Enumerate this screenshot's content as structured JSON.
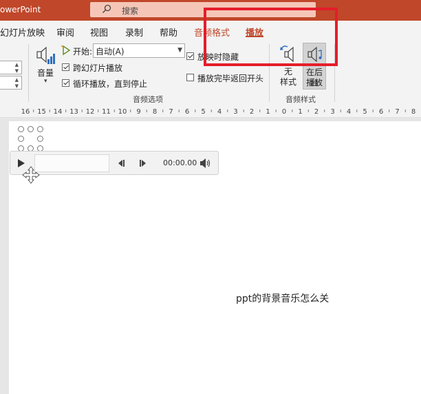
{
  "title_bar": {
    "app_title": "owerPoint",
    "search_label": "搜索"
  },
  "tabs": {
    "slideshow": "幻灯片放映",
    "review": "审阅",
    "view": "视图",
    "record": "录制",
    "help": "帮助",
    "audio_format": "音频格式",
    "playback": "播放"
  },
  "ribbon": {
    "volume_label": "音量",
    "start_label": "开始:",
    "start_value": "自动(A)",
    "cross_slides_label": "跨幻灯片播放",
    "loop_label": "循环播放，直到停止",
    "hide_label": "放映时隐藏",
    "rewind_label": "播放完毕返回开头",
    "audio_options_label": "音频选项",
    "no_style_label_1": "无",
    "no_style_label_2": "样式",
    "bg_play_label_1": "在后台",
    "bg_play_label_2": "播放",
    "audio_styles_label": "音频样式",
    "checkboxes": {
      "cross_slides": true,
      "loop": true,
      "hide": true,
      "rewind": false
    }
  },
  "ruler": {
    "left_numbers": [
      "16",
      "15",
      "14",
      "13",
      "12",
      "11",
      "10",
      "9",
      "8",
      "7",
      "6",
      "5",
      "4",
      "3",
      "2",
      "1",
      "0"
    ],
    "right_numbers": [
      "1",
      "2",
      "3",
      "4",
      "5",
      "6",
      "7",
      "8"
    ]
  },
  "audio_player": {
    "time": "00:00.00"
  },
  "slide": {
    "caption": "ppt的背景音乐怎么关"
  },
  "colors": {
    "accent": "#c0472a",
    "highlight": "#e51d2a",
    "search_bg": "#f5c6b8"
  },
  "icons": [
    "search-icon",
    "volume-icon",
    "start-icon",
    "no-style-icon",
    "bg-play-icon",
    "play-icon",
    "skip-back-icon",
    "skip-forward-icon",
    "speaker-icon",
    "move-icon"
  ]
}
